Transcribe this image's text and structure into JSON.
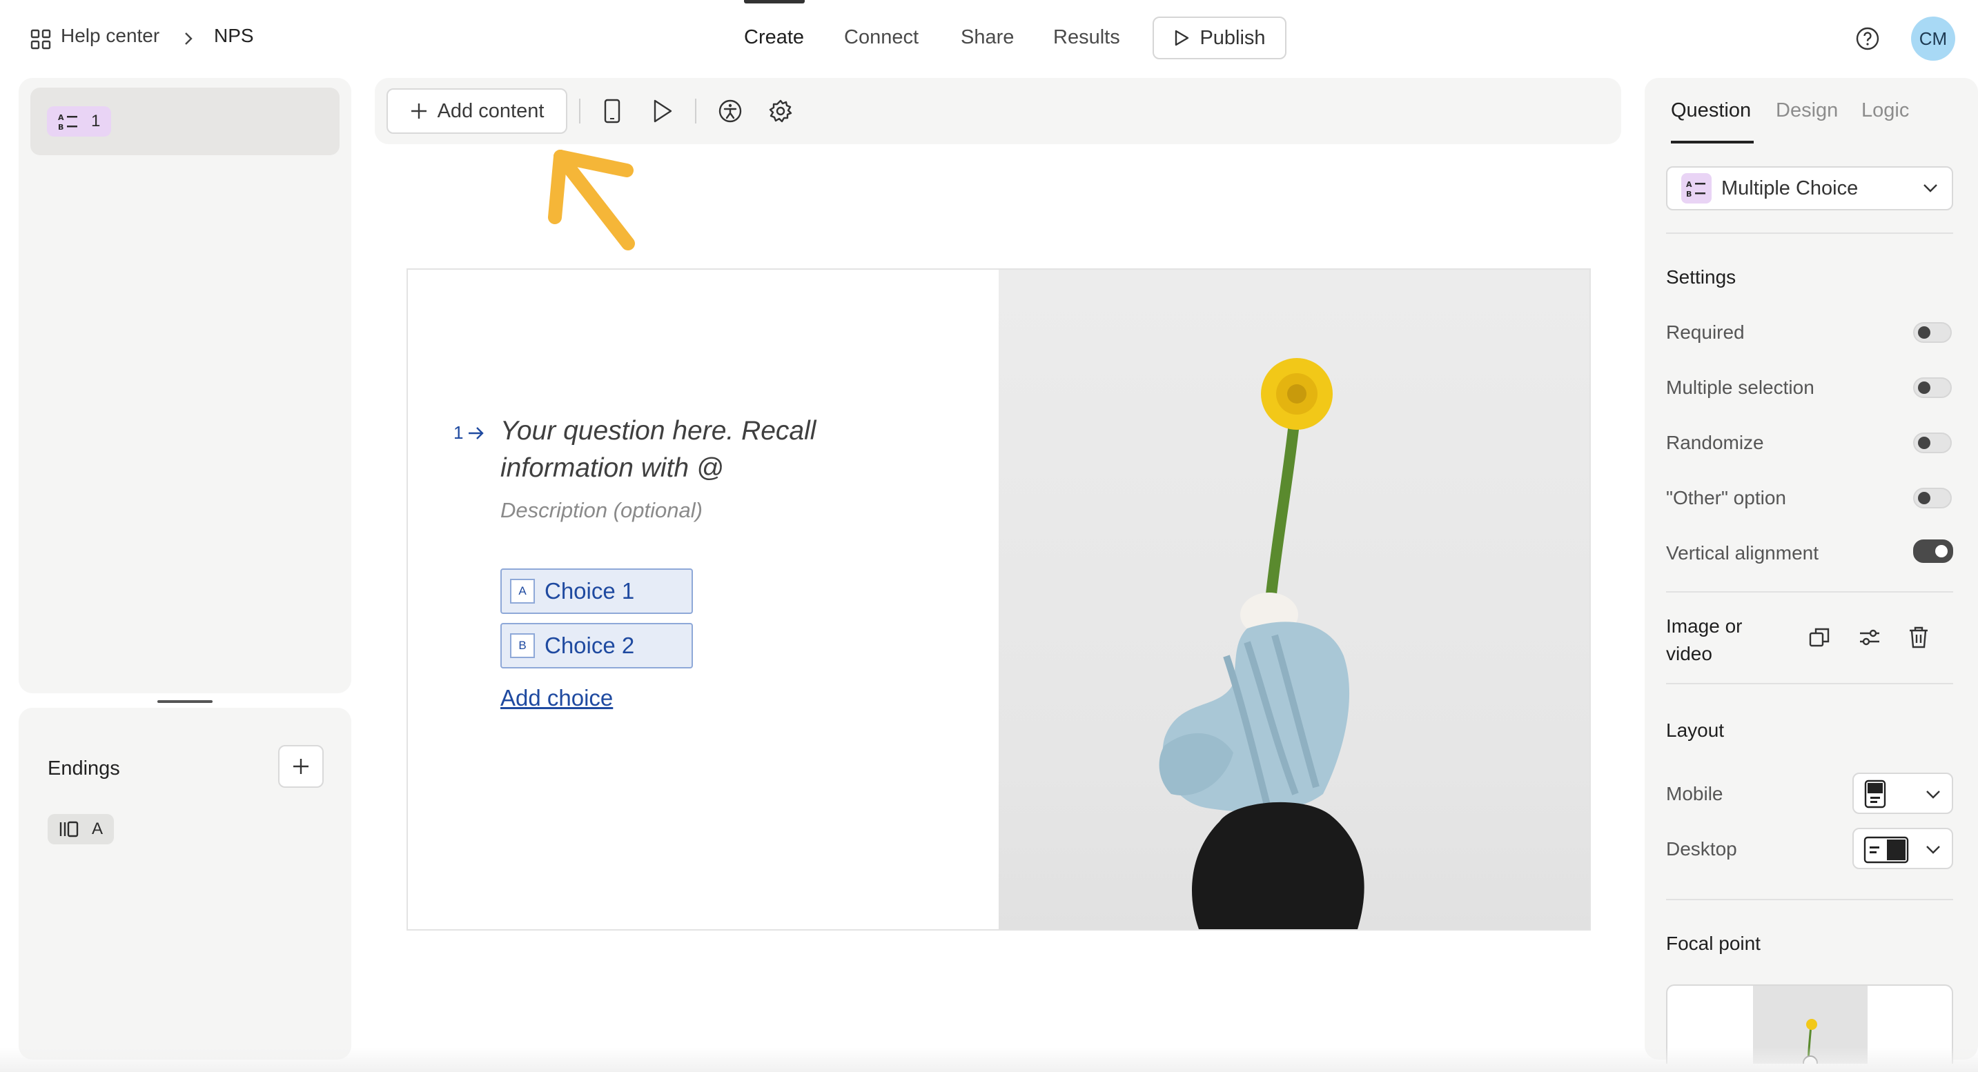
{
  "breadcrumb": {
    "workspace": "Help center",
    "form": "NPS"
  },
  "nav": {
    "tabs": [
      "Create",
      "Connect",
      "Share",
      "Results"
    ],
    "active": "Create",
    "publish_label": "Publish"
  },
  "user": {
    "initials": "CM"
  },
  "left": {
    "question_number": "1",
    "endings_label": "Endings",
    "ending_letter": "A"
  },
  "toolbar": {
    "add_content_label": "Add content"
  },
  "question": {
    "number": "1",
    "text": "Your question here. Recall information with @",
    "description": "Description (optional)",
    "choices": [
      {
        "key": "A",
        "label": "Choice 1"
      },
      {
        "key": "B",
        "label": "Choice 2"
      }
    ],
    "add_choice_label": "Add choice"
  },
  "right": {
    "tabs": [
      "Question",
      "Design",
      "Logic"
    ],
    "active_tab": "Question",
    "type_label": "Multiple Choice",
    "settings_heading": "Settings",
    "settings": [
      {
        "label": "Required",
        "on": false
      },
      {
        "label": "Multiple selection",
        "on": false
      },
      {
        "label": "Randomize",
        "on": false
      },
      {
        "label": "\"Other\" option",
        "on": false
      },
      {
        "label": "Vertical alignment",
        "on": true
      }
    ],
    "image_or_video_label": "Image or video",
    "layout_heading": "Layout",
    "layout_mobile_label": "Mobile",
    "layout_desktop_label": "Desktop",
    "focal_point_heading": "Focal point"
  },
  "colors": {
    "accent_blue": "#1f4aa0",
    "question_badge": "#e9d4f5",
    "arrow_annotation": "#f5b638",
    "avatar": "#a8d9f5"
  }
}
